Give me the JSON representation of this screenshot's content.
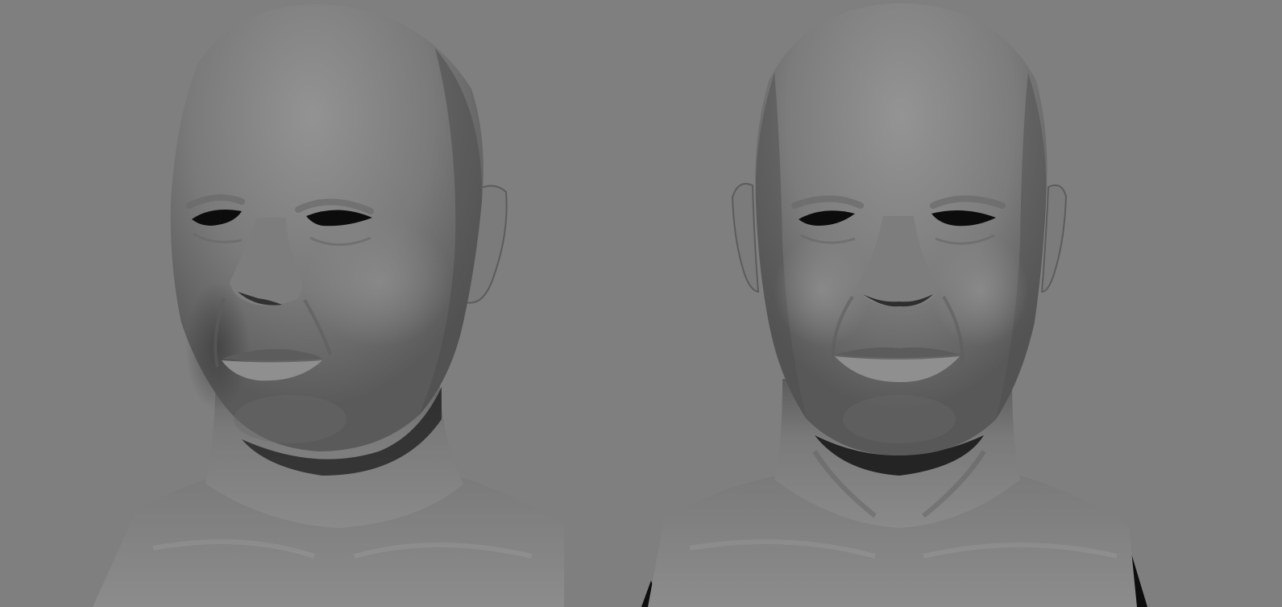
{
  "viewport": {
    "background": "#7f7f7f",
    "renders": [
      {
        "name": "head-render-three-quarter",
        "view": "three-quarter"
      },
      {
        "name": "head-render-front",
        "view": "front"
      }
    ],
    "colors": {
      "skin_light": "#8e8e8e",
      "skin_mid": "#757575",
      "skin_dark": "#4e4e4e",
      "cavity": "#0c0c0c"
    }
  }
}
